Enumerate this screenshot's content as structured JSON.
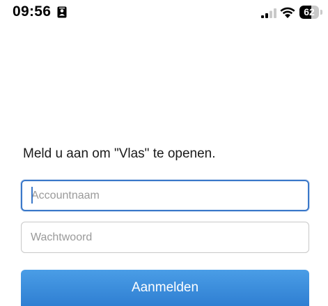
{
  "status_bar": {
    "time": "09:56",
    "battery_level": "62",
    "battery_fraction": 0.62,
    "icons": [
      "id-card-icon",
      "cellular-signal-icon",
      "wifi-icon",
      "battery-icon"
    ]
  },
  "login": {
    "prompt": "Meld u aan om \"Vlas\" te openen.",
    "account_placeholder": "Accountnaam",
    "account_value": "",
    "password_placeholder": "Wachtwoord",
    "password_value": "",
    "submit_label": "Aanmelden"
  },
  "colors": {
    "accent": "#3a78c9",
    "button": "#3d8fdd",
    "background": "#ffffff"
  }
}
